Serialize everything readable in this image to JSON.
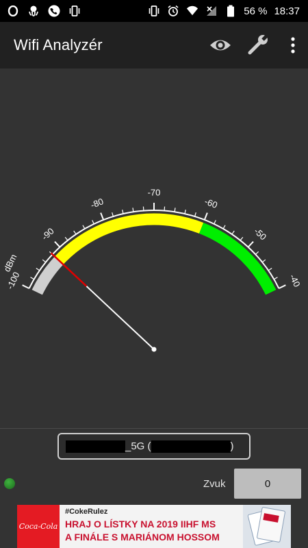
{
  "status_bar": {
    "battery": "56 %",
    "time": "18:37"
  },
  "app": {
    "title": "Wifi Analyzér",
    "icons": [
      "eye-icon",
      "wrench-icon",
      "overflow-menu-icon"
    ]
  },
  "gauge": {
    "unit": "dBm",
    "scale_labels": [
      "-100",
      "-90",
      "-80",
      "-70",
      "-60",
      "-50",
      "-40"
    ],
    "min": -100,
    "max": -40,
    "needle_value": -92,
    "zones": [
      {
        "from": -100,
        "to": -92,
        "color": "#cfcfcf"
      },
      {
        "from": -92,
        "to": -60,
        "color": "#ffff00"
      },
      {
        "from": -60,
        "to": -40,
        "color": "#00ee00"
      }
    ]
  },
  "network": {
    "label_middle": "_5G (",
    "label_end": ")"
  },
  "sound": {
    "label": "Zvuk",
    "value": "0"
  },
  "ad": {
    "brand": "Coca-Cola",
    "tag": "#CokeRulez",
    "line1": "HRAJ O LÍSTKY NA 2019 IIHF MS",
    "line2": "A FINÁLE S MARIÁNOM HOSSOM"
  }
}
